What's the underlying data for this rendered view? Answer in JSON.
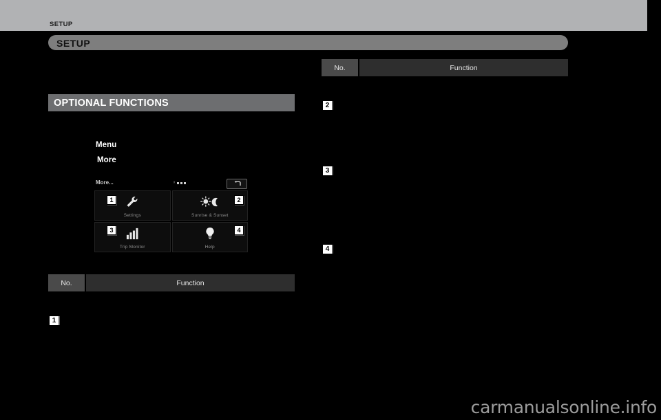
{
  "page": {
    "running_head": "SETUP",
    "chapter_title": "SETUP",
    "watermark": "carmanualsonline.info"
  },
  "left_column": {
    "section_heading": "OPTIONAL FUNCTIONS",
    "body_terms": [
      {
        "text": "Menu"
      },
      {
        "text": "More"
      }
    ],
    "table": {
      "header_no": "No.",
      "header_function": "Function",
      "rows": [
        {
          "no": "1",
          "function": ""
        }
      ]
    }
  },
  "right_column": {
    "table": {
      "header_no": "No.",
      "header_function": "Function",
      "rows": [
        {
          "no": "2",
          "function": ""
        },
        {
          "no": "3",
          "function": ""
        },
        {
          "no": "4",
          "function": ""
        }
      ]
    }
  },
  "device_screen": {
    "title": "More...",
    "page_indicator": {
      "mark": "ˣ",
      "dots": 3
    },
    "back_button_icon": "back-arrow-icon",
    "tiles": [
      {
        "callout": "1",
        "label": "Settings",
        "icon": "wrench-icon"
      },
      {
        "callout": "2",
        "label": "Sunrise & Sunset",
        "icon": "sun-moon-icon"
      },
      {
        "callout": "3",
        "label": "Trip Monitor",
        "icon": "bar-chart-icon"
      },
      {
        "callout": "4",
        "label": "Help",
        "icon": "lightbulb-icon"
      }
    ]
  },
  "colors": {
    "page_background": "#000000",
    "running_head_band": "#b1b2b4",
    "chapter_pill": "#7e7e7e",
    "section_bar": "#6d6e70",
    "table_head_no": "#4a4a4a",
    "table_head_function": "#2e2e2e",
    "watermark": "#9c9c9c"
  }
}
